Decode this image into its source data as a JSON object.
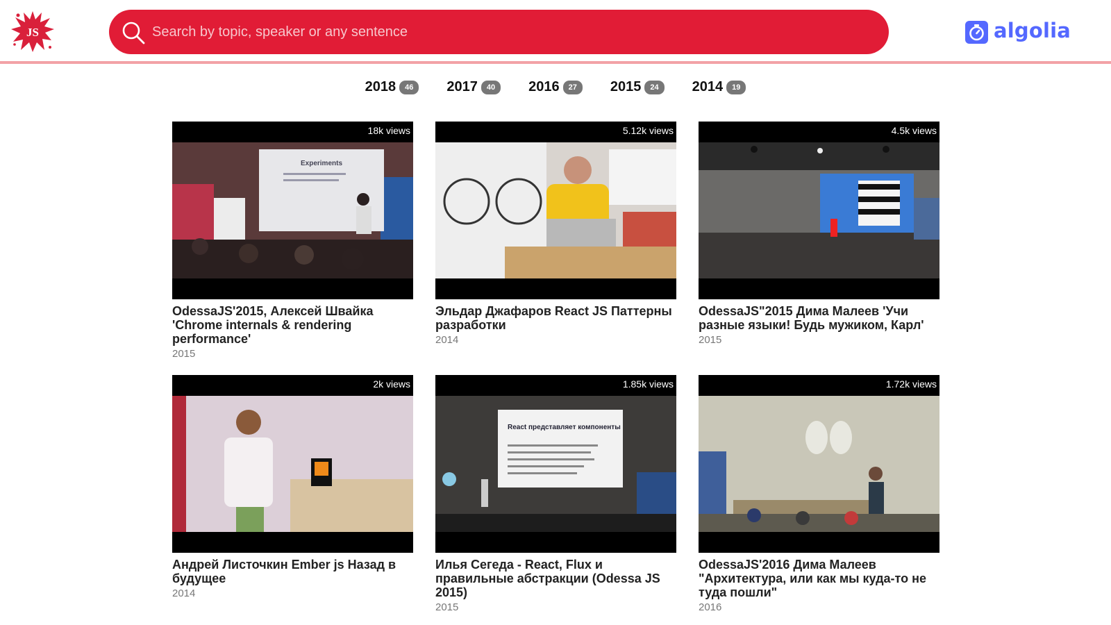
{
  "search": {
    "placeholder": "Search by topic, speaker or any sentence",
    "value": ""
  },
  "brand": {
    "logo_icon": "odessajs-splash-logo",
    "accent": "#e11c36",
    "divider": "#f2a2a6"
  },
  "algolia": {
    "label": "algolia",
    "color": "#5468ff"
  },
  "years": [
    {
      "year": "2018",
      "count": "46"
    },
    {
      "year": "2017",
      "count": "40"
    },
    {
      "year": "2016",
      "count": "27"
    },
    {
      "year": "2015",
      "count": "24"
    },
    {
      "year": "2014",
      "count": "19"
    }
  ],
  "videos": [
    {
      "views": "18k views",
      "title": "OdessaJS'2015, Алексей Швайка 'Chrome internals & rendering performance'",
      "year": "2015",
      "slide_text": "Experiments"
    },
    {
      "views": "5.12k views",
      "title": "Эльдар Джафаров React JS Паттерны разработки",
      "year": "2014"
    },
    {
      "views": "4.5k views",
      "title": "OdessaJS\"2015 Дима Малеев 'Учи разные языки! Будь мужиком, Карл'",
      "year": "2015"
    },
    {
      "views": "2k views",
      "title": "Андрей Листочкин Ember js Назад в будущее",
      "year": "2014"
    },
    {
      "views": "1.85k views",
      "title": "Илья Сегеда - React, Flux и правильные абстракции (Odessa JS 2015)",
      "year": "2015",
      "slide_text": "React представляет компоненты"
    },
    {
      "views": "1.72k views",
      "title": "OdessaJS'2016 Дима Малеев \"Архитектура, или как мы куда-то не туда пошли\"",
      "year": "2016"
    }
  ]
}
